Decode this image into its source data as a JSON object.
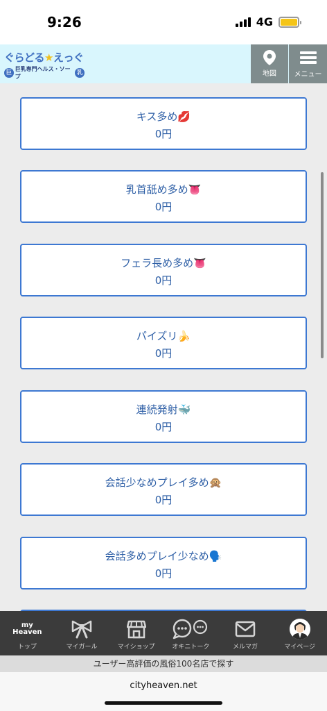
{
  "status": {
    "time": "9:26",
    "network": "4G"
  },
  "header": {
    "logo_title_a": "ぐらどる",
    "logo_title_star": "★",
    "logo_title_b": "えっぐ",
    "logo_badge_left": "巨",
    "logo_subtitle": "巨乳専門ヘルス・ソープ",
    "logo_badge_right": "乳",
    "map_label": "地図",
    "menu_label": "メニュー"
  },
  "options": [
    {
      "title": "キス多め💋",
      "price": "0円"
    },
    {
      "title": "乳首舐め多め👅",
      "price": "0円"
    },
    {
      "title": "フェラ長め多め👅",
      "price": "0円"
    },
    {
      "title": "パイズリ🍌",
      "price": "0円"
    },
    {
      "title": "連続発射🐳",
      "price": "0円"
    },
    {
      "title": "会話少なめプレイ多め🙊",
      "price": "0円"
    },
    {
      "title": "会話多めプレイ少なめ🗣️",
      "price": "0円"
    }
  ],
  "nav": {
    "items": [
      {
        "label": "トップ",
        "icon": "my-heaven-icon",
        "logo_a": "my",
        "logo_b": "Heaven"
      },
      {
        "label": "マイガール",
        "icon": "ribbon-icon"
      },
      {
        "label": "マイショップ",
        "icon": "shop-icon"
      },
      {
        "label": "オキニトーク",
        "icon": "chat-bubbles-icon"
      },
      {
        "label": "メルマガ",
        "icon": "mail-icon"
      },
      {
        "label": "マイページ",
        "icon": "avatar-icon"
      }
    ]
  },
  "promo": "ユーザー高評価の風俗100名店で探す",
  "browser": {
    "url": "cityheaven.net"
  },
  "colors": {
    "accent": "#3d78d2",
    "text": "#2e5fa6",
    "header_bg": "#d9f6fd",
    "nav_bg": "#3b3b3b"
  }
}
